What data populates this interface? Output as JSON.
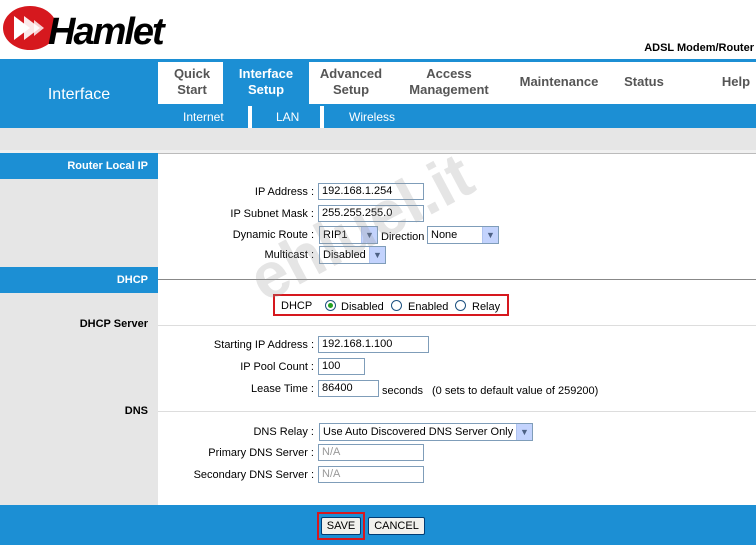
{
  "brand": {
    "logo_text": "Hamlet",
    "product": "ADSL Modem/Router"
  },
  "nav": {
    "section_label": "Interface",
    "tabs": [
      {
        "label": "Quick\nStart"
      },
      {
        "label": "Interface\nSetup"
      },
      {
        "label": "Advanced\nSetup"
      },
      {
        "label": "Access\nManagement"
      },
      {
        "label": "Maintenance"
      },
      {
        "label": "Status"
      },
      {
        "label": "Help"
      }
    ],
    "subtabs": [
      "Internet",
      "LAN",
      "Wireless"
    ]
  },
  "router_local_ip": {
    "title": "Router Local IP",
    "ip_address_label": "IP Address :",
    "ip_address": "192.168.1.254",
    "subnet_label": "IP Subnet Mask :",
    "subnet": "255.255.255.0",
    "dynamic_route_label": "Dynamic Route :",
    "dynamic_route": "RIP1",
    "direction_label": "Direction",
    "direction": "None",
    "multicast_label": "Multicast :",
    "multicast": "Disabled"
  },
  "dhcp": {
    "title": "DHCP",
    "dhcp_label": "DHCP",
    "options": [
      "Disabled",
      "Enabled",
      "Relay"
    ],
    "selected": "Disabled"
  },
  "dhcp_server": {
    "title": "DHCP Server",
    "start_ip_label": "Starting IP Address :",
    "start_ip": "192.168.1.100",
    "pool_label": "IP Pool Count :",
    "pool": "100",
    "lease_label": "Lease Time :",
    "lease": "86400",
    "lease_unit": "seconds",
    "lease_note": "(0 sets to default value of 259200)"
  },
  "dns": {
    "title": "DNS",
    "relay_label": "DNS Relay :",
    "relay": "Use Auto Discovered DNS Server Only",
    "primary_label": "Primary DNS Server :",
    "primary": "N/A",
    "secondary_label": "Secondary DNS Server :",
    "secondary": "N/A"
  },
  "actions": {
    "save": "SAVE",
    "cancel": "CANCEL"
  },
  "watermark": "ehluel.it",
  "colors": {
    "accent": "#1c8fd4",
    "highlight": "#d6181e",
    "logo_red": "#d6181e"
  }
}
